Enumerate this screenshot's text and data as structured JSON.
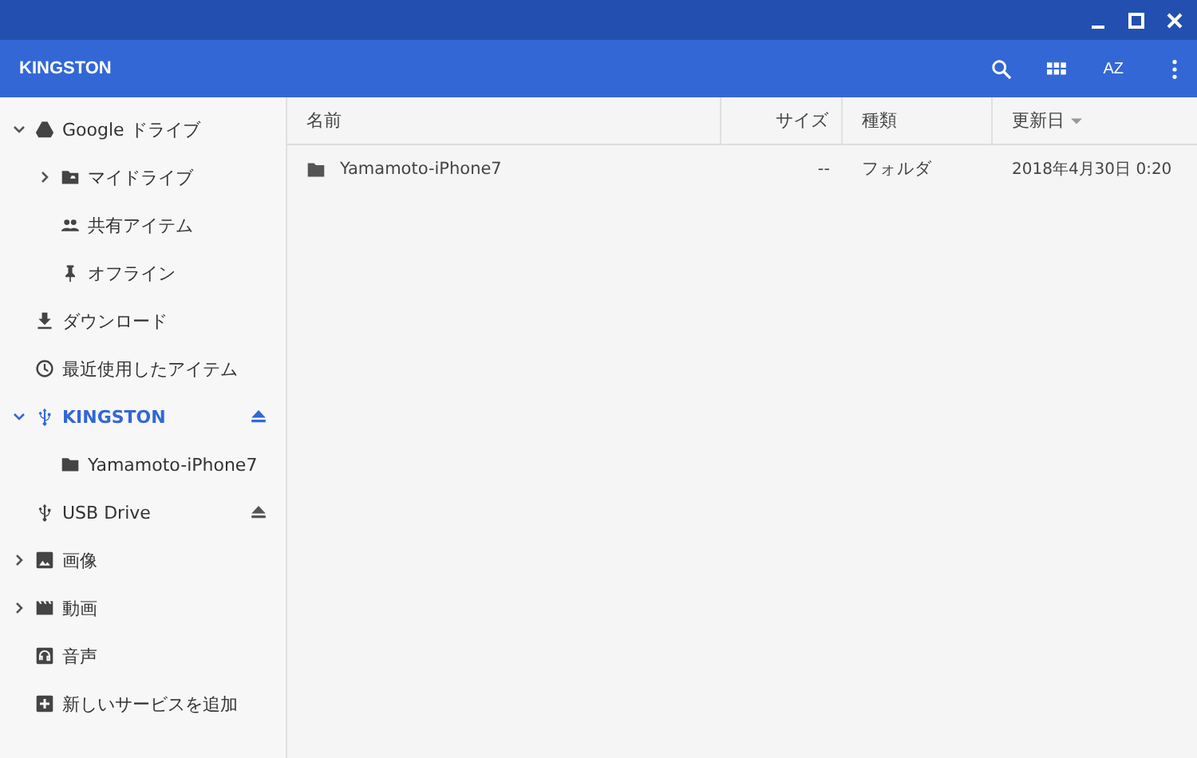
{
  "window": {
    "title": "KINGSTON"
  },
  "toolbar": {
    "sort_label": "AZ"
  },
  "sidebar": {
    "items": [
      {
        "label": "Google ドライブ",
        "kind": "drive",
        "expanded": true,
        "selected": false,
        "children": [
          {
            "label": "マイドライブ",
            "kind": "drive-folder",
            "expanded": false,
            "selected": false
          },
          {
            "label": "共有アイテム",
            "kind": "people",
            "selected": false
          },
          {
            "label": "オフライン",
            "kind": "pin",
            "selected": false
          }
        ]
      },
      {
        "label": "ダウンロード",
        "kind": "download",
        "selected": false
      },
      {
        "label": "最近使用したアイテム",
        "kind": "clock",
        "selected": false
      },
      {
        "label": "KINGSTON",
        "kind": "usb",
        "expanded": true,
        "selected": true,
        "children": [
          {
            "label": "Yamamoto-iPhone7",
            "kind": "folder",
            "selected": false
          }
        ]
      },
      {
        "label": "USB Drive",
        "kind": "usb",
        "selected": false
      },
      {
        "label": "画像",
        "kind": "image",
        "expanded": false,
        "selected": false
      },
      {
        "label": "動画",
        "kind": "video",
        "expanded": false,
        "selected": false
      },
      {
        "label": "音声",
        "kind": "audio",
        "selected": false
      },
      {
        "label": "新しいサービスを追加",
        "kind": "add",
        "selected": false
      }
    ]
  },
  "table": {
    "columns": [
      {
        "label": "名前",
        "sorted": false
      },
      {
        "label": "サイズ",
        "sorted": false
      },
      {
        "label": "種類",
        "sorted": false
      },
      {
        "label": "更新日",
        "sorted": true
      }
    ],
    "rows": [
      {
        "name": "Yamamoto-iPhone7",
        "size": "--",
        "type": "フォルダ",
        "modified": "2018年4月30日 0:20",
        "selected": false
      }
    ]
  }
}
